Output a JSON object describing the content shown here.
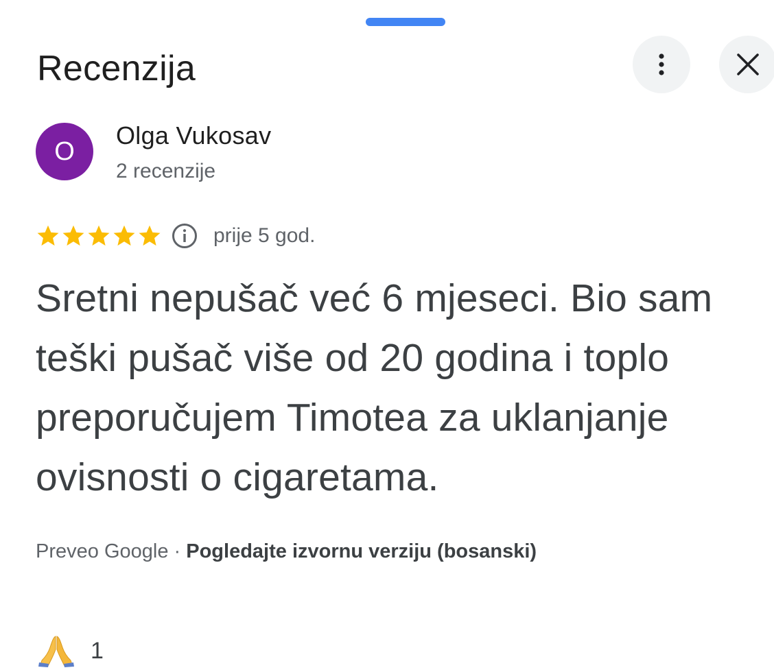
{
  "sheet": {
    "title": "Recenzija",
    "more_icon": "more-vert-icon",
    "close_icon": "close-icon"
  },
  "author": {
    "avatar_letter": "O",
    "avatar_color": "#7b1fa2",
    "name": "Olga Vukosav",
    "meta": "2 recenzije"
  },
  "rating": {
    "stars": 5,
    "max_stars": 5,
    "star_color": "#fbbc04",
    "time": "prije 5 god."
  },
  "review": {
    "text": "Sretni nepušač već 6 mjeseci. Bio sam teški pušač više od 20 godina i toplo preporučujem Timotea za uklanjanje ovisnosti o cigaretama."
  },
  "translation": {
    "prefix": "Preveo Google",
    "separator": " · ",
    "link": "Pogledajte izvornu verziju (bosanski)"
  },
  "reaction": {
    "icon": "praying-hands-emoji",
    "count": "1"
  },
  "accent": "#4285f4"
}
